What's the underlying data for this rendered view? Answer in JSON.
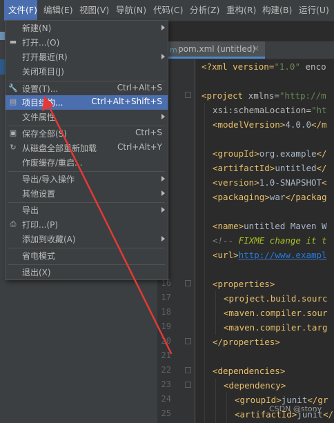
{
  "menubar": {
    "items": [
      {
        "label": "文件(F)",
        "active": true
      },
      {
        "label": "编辑(E)"
      },
      {
        "label": "视图(V)"
      },
      {
        "label": "导航(N)"
      },
      {
        "label": "代码(C)"
      },
      {
        "label": "分析(Z)"
      },
      {
        "label": "重构(R)"
      },
      {
        "label": "构建(B)"
      },
      {
        "label": "运行(U)"
      }
    ]
  },
  "file_menu": {
    "items": [
      {
        "label": "新建(N)",
        "shortcut": "",
        "submenu": true,
        "icon": ""
      },
      {
        "label": "打开...(O)",
        "shortcut": "",
        "submenu": false,
        "icon": "folder-icon"
      },
      {
        "label": "打开最近(R)",
        "shortcut": "",
        "submenu": true,
        "icon": ""
      },
      {
        "label": "关闭项目(J)",
        "shortcut": "",
        "submenu": false,
        "icon": ""
      },
      {
        "label": "设置(T)...",
        "shortcut": "Ctrl+Alt+S",
        "submenu": false,
        "icon": "wrench-icon"
      },
      {
        "label": "项目结构...",
        "shortcut": "Ctrl+Alt+Shift+S",
        "submenu": false,
        "icon": "project-structure-icon",
        "selected": true
      },
      {
        "label": "文件属性",
        "shortcut": "",
        "submenu": true,
        "icon": ""
      },
      {
        "label": "保存全部(S)",
        "shortcut": "Ctrl+S",
        "submenu": false,
        "icon": "save-icon"
      },
      {
        "label": "从磁盘全部重新加载",
        "shortcut": "Ctrl+Alt+Y",
        "submenu": false,
        "icon": "reload-icon"
      },
      {
        "label": "作废缓存/重启...",
        "shortcut": "",
        "submenu": false,
        "icon": ""
      },
      {
        "label": "导出/导入操作",
        "shortcut": "",
        "submenu": true,
        "icon": ""
      },
      {
        "label": "其他设置",
        "shortcut": "",
        "submenu": true,
        "icon": ""
      },
      {
        "label": "导出",
        "shortcut": "",
        "submenu": true,
        "icon": ""
      },
      {
        "label": "打印...(P)",
        "shortcut": "",
        "submenu": false,
        "icon": "print-icon"
      },
      {
        "label": "添加到收藏(A)",
        "shortcut": "",
        "submenu": true,
        "icon": ""
      },
      {
        "label": "省电模式",
        "shortcut": "",
        "submenu": false,
        "icon": ""
      },
      {
        "label": "退出(X)",
        "shortcut": "",
        "submenu": false,
        "icon": ""
      }
    ]
  },
  "editor": {
    "tab_label": "pom.xml (untitled)",
    "line_numbers": [
      "16",
      "17",
      "18",
      "19",
      "20",
      "21",
      "22",
      "23",
      "24",
      "25"
    ]
  },
  "code": {
    "l1_a": "<?xml version=",
    "l1_b": "\"1.0\"",
    "l1_c": " enco",
    "l3_a": "<project ",
    "l3_b": "xmlns=",
    "l3_c": "\"http://m",
    "l4_a": "xsi:schemaLocation=",
    "l4_b": "\"ht",
    "l5_a": "<modelVersion>",
    "l5_b": "4.0.0",
    "l5_c": "</m",
    "l7_a": "<groupId>",
    "l7_b": "org.example",
    "l7_c": "</",
    "l8_a": "<artifactId>",
    "l8_b": "untitled",
    "l8_c": "</",
    "l9_a": "<version>",
    "l9_b": "1.0-SNAPSHOT",
    "l9_c": "<",
    "l10_a": "<packaging>",
    "l10_b": "war",
    "l10_c": "</packag",
    "l12_a": "<name>",
    "l12_b": "untitled Maven W",
    "l13_a": "<!-- ",
    "l13_b": "FIXME change it t",
    "l14_a": "<url>",
    "l14_b": "http://www.exampl",
    "l16": "<properties>",
    "l17_a": "<project.build.sourc",
    "l18_a": "<maven.compiler.sour",
    "l19_a": "<maven.compiler.targ",
    "l20": "</properties>",
    "l22": "<dependencies>",
    "l23": "<dependency>",
    "l24_a": "<groupId>",
    "l24_b": "junit",
    "l24_c": "</gr",
    "l25_a": "<artifactId>",
    "l25_b": "junit",
    "l25_c": "</"
  },
  "watermark": "CSDN @stony",
  "colors": {
    "menu_bg": "#3c3f41",
    "selection": "#4b6eaf",
    "annotation_arrow": "#e53935",
    "xml_tag": "#e8bf6a",
    "xml_string": "#6a8759"
  }
}
